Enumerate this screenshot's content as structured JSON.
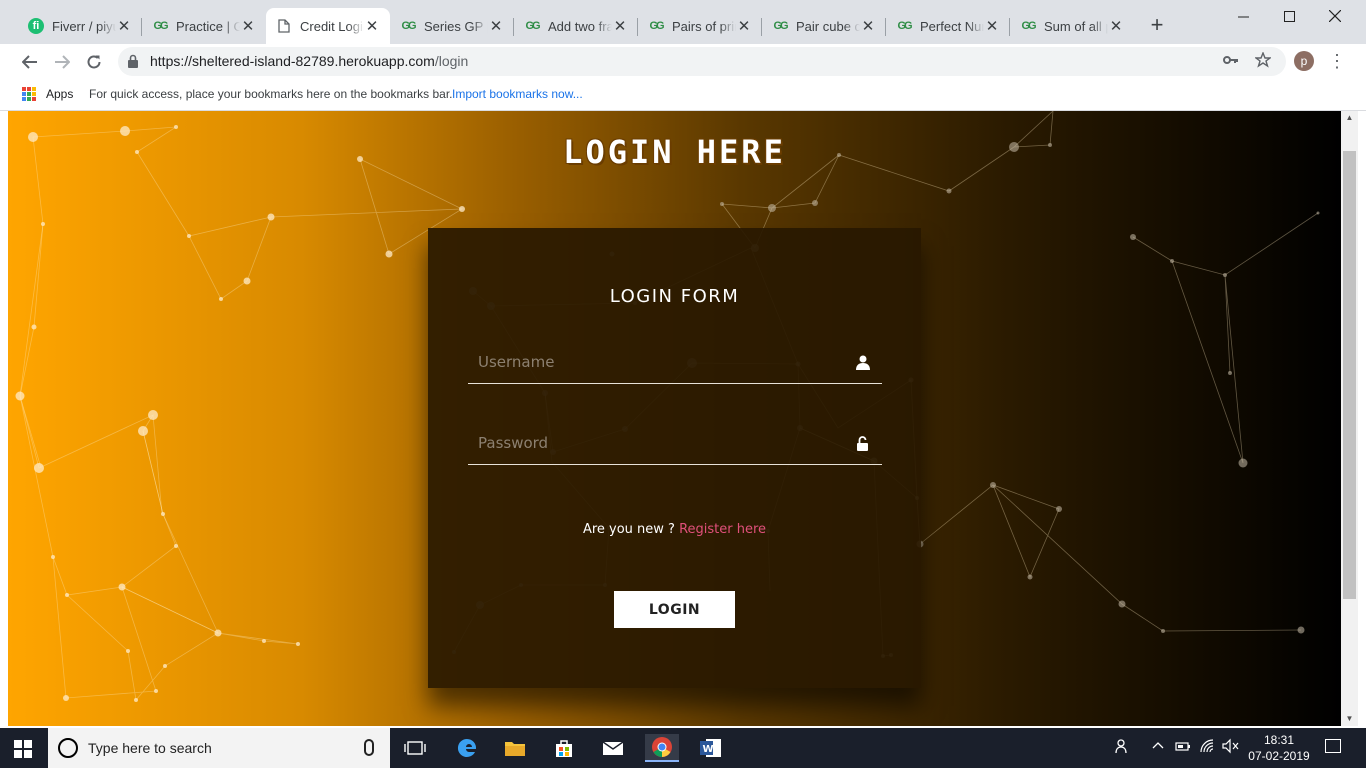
{
  "browser": {
    "tabs": [
      {
        "title": "Fiverr / piyu",
        "favicon": "fiverr-icon"
      },
      {
        "title": "Practice | G",
        "favicon": "gfg-icon"
      },
      {
        "title": "Credit Login",
        "favicon": "document-icon"
      },
      {
        "title": "Series GP |",
        "favicon": "gfg-icon"
      },
      {
        "title": "Add two fra",
        "favicon": "gfg-icon"
      },
      {
        "title": "Pairs of prin",
        "favicon": "gfg-icon"
      },
      {
        "title": "Pair cube co",
        "favicon": "gfg-icon"
      },
      {
        "title": "Perfect Nur",
        "favicon": "gfg-icon"
      },
      {
        "title": "Sum of all p",
        "favicon": "gfg-icon"
      }
    ],
    "active_tab_index": 2,
    "url_host": "https://sheltered-island-82789.herokuapp.com",
    "url_path": "/login",
    "profile_initial": "p",
    "bookmarks": {
      "apps_label": "Apps",
      "hint": "For quick access, place your bookmarks here on the bookmarks bar.",
      "import_link": "Import bookmarks now..."
    }
  },
  "page": {
    "hero_title": "LOGIN HERE",
    "form_title": "LOGIN FORM",
    "username_placeholder": "Username",
    "password_placeholder": "Password",
    "register_prompt": "Are you new ?",
    "register_link": "Register here",
    "login_button": "LOGIN"
  },
  "taskbar": {
    "search_placeholder": "Type here to search",
    "time": "18:31",
    "date": "07-02-2019"
  },
  "colors": {
    "gradient_start": "#ffa500",
    "gradient_end": "#000000",
    "register_link": "#e0507a",
    "card_bg": "#281800"
  }
}
